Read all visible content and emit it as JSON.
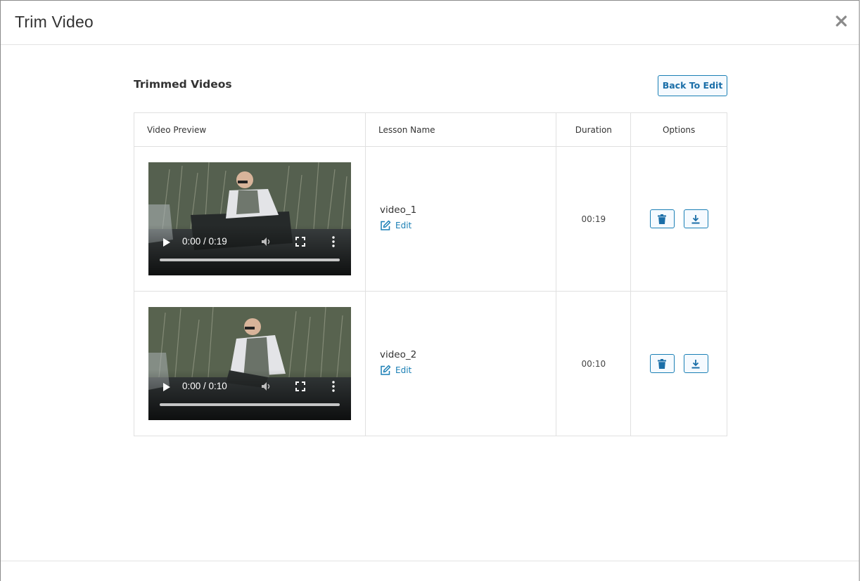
{
  "modal": {
    "title": "Trim Video",
    "close_icon": "close-icon"
  },
  "section": {
    "title": "Trimmed Videos",
    "back_label": "Back To Edit"
  },
  "table": {
    "headers": {
      "preview": "Video Preview",
      "lesson": "Lesson Name",
      "duration": "Duration",
      "options": "Options"
    },
    "rows": [
      {
        "player_time": "0:00 / 0:19",
        "lesson_name": "video_1",
        "edit_label": "Edit",
        "duration": "00:19"
      },
      {
        "player_time": "0:00 / 0:10",
        "lesson_name": "video_2",
        "edit_label": "Edit",
        "duration": "00:10"
      }
    ]
  },
  "icons": {
    "delete": "trash-icon",
    "download": "download-icon",
    "edit": "edit-icon",
    "play": "play-icon",
    "mute": "volume-icon",
    "fullscreen": "fullscreen-icon",
    "more": "more-options-icon"
  },
  "colors": {
    "accent": "#1a7fb5",
    "border": "#e0e0e0",
    "button_bg": "#f5faff"
  }
}
